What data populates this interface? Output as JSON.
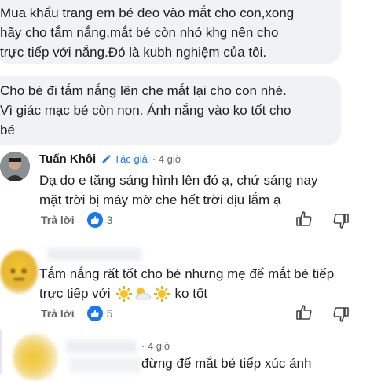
{
  "comment1": {
    "text_lines": [
      "Mua khẩu trang em bé đeo vào mắt cho con,xong",
      "hãy cho tắm nắng,mắt bé còn nhỏ khg nên cho",
      "trực tiếp với nắng.Đó là kubh nghiệm của tôi."
    ]
  },
  "comment2": {
    "text_lines": [
      "Cho bé đi tắm nắng lên che mắt lại cho con nhé.",
      "Vì giác mạc bé còn non. Ánh nắng vào ko tốt cho",
      "bé"
    ]
  },
  "reply1": {
    "author": "Tuấn Khôi",
    "badge": "Tác giả",
    "time": "· 4 giờ",
    "text_lines": [
      "Dạ do e tăng sáng hình lên đó ạ, chứ sáng nay",
      "mặt trời bị máy mờ che hết trời dịu lắm ạ"
    ],
    "reply_label": "Trả lời",
    "like_count": "3"
  },
  "reply2": {
    "text_lines": [
      "Tắm nắng rất tốt cho bé nhưng mẹ để mắt bé tiếp",
      "trực tiếp với",
      "ko tốt"
    ],
    "reply_label": "Trả lời",
    "like_count": "5"
  },
  "reply3": {
    "time": "· 4 giờ",
    "text_partial": "đừng để mắt bé tiếp xúc  ánh"
  },
  "colors": {
    "accent": "#1877f2",
    "bubble": "#f0f2f5",
    "muted": "#65676b"
  }
}
